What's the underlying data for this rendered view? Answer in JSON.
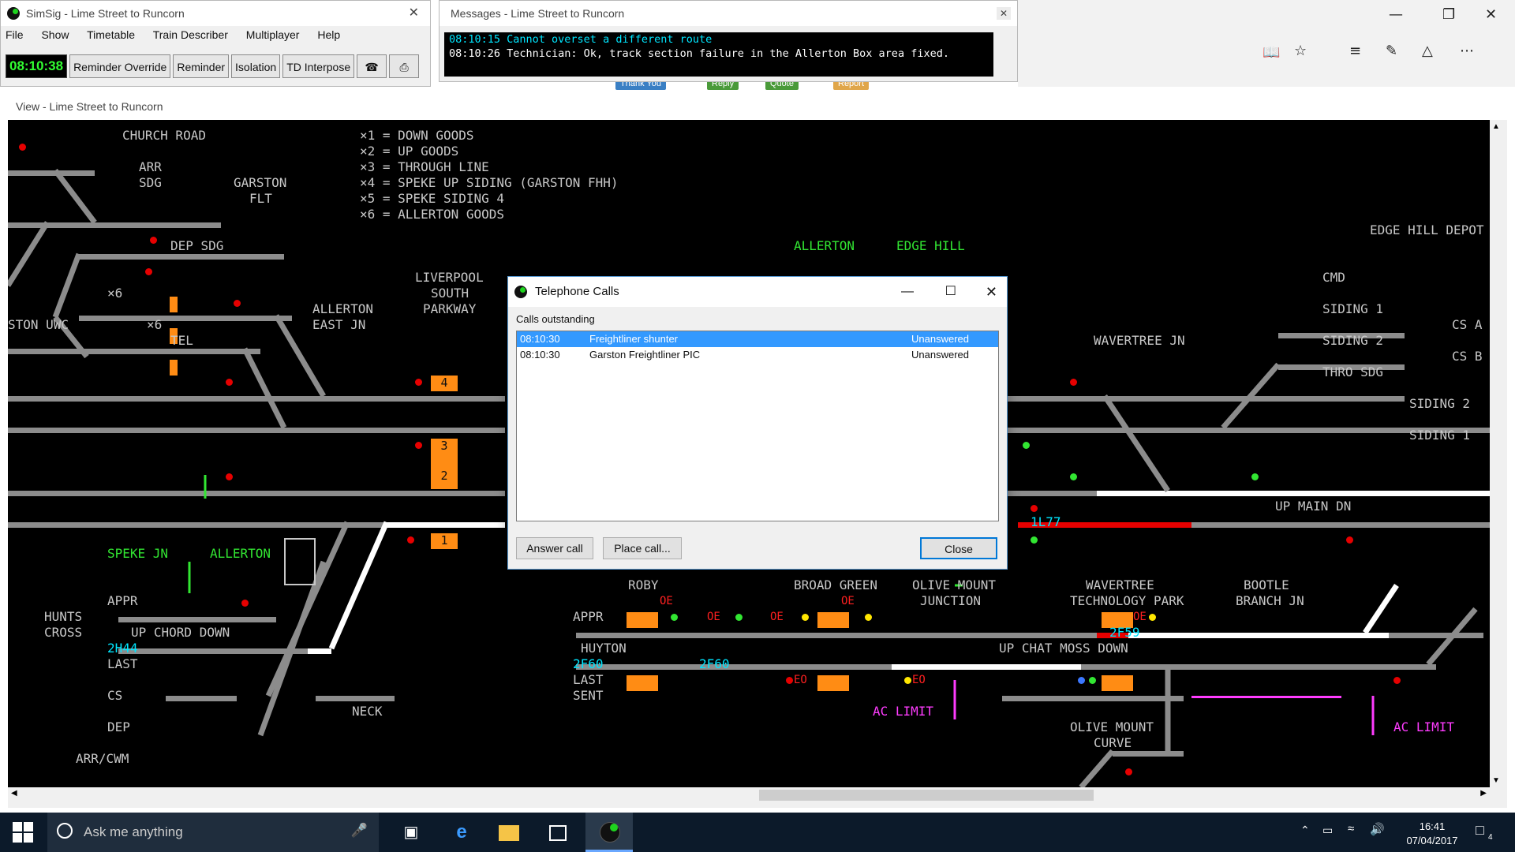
{
  "simsig": {
    "title": "SimSig - Lime Street to Runcorn",
    "menu": [
      "File",
      "Show",
      "Timetable",
      "Train Describer",
      "Multiplayer",
      "Help"
    ],
    "clock": "08:10:38",
    "toolbar": [
      "Reminder Override",
      "Reminder",
      "Isolation",
      "TD Interpose"
    ]
  },
  "messages": {
    "title": "Messages - Lime Street to Runcorn",
    "lines": [
      {
        "text": "08:10:15 Cannot overset a different route",
        "color": "#00e6ff"
      },
      {
        "text": "08:10:26 Technician: Ok, track section failure in the Allerton Box area fixed.",
        "color": "#ffffff"
      }
    ]
  },
  "forum_buttons": [
    "Thank You",
    "Reply",
    "Quote",
    "Report"
  ],
  "view": {
    "title": "View - Lime Street to Runcorn",
    "legend": [
      "×1 = DOWN GOODS",
      "×2 = UP GOODS",
      "×3 = THROUGH LINE",
      "×4 = SPEKE UP SIDING (GARSTON FHH)",
      "×5 = SPEKE SIDING 4",
      "×6 = ALLERTON GOODS"
    ],
    "labels": {
      "church_road": "CHURCH ROAD",
      "arr": "ARR",
      "sdg": "SDG",
      "garston": "GARSTON",
      "flt": "FLT",
      "dep_sdg": "DEP SDG",
      "x6a": "×6",
      "x6b": "×6",
      "ton_uwc": "STON UWC",
      "tel": "TEL",
      "liverpool": "LIVERPOOL",
      "south": "SOUTH",
      "parkway": "PARKWAY",
      "allerton_east": "ALLERTON",
      "east_jn": "EAST JN",
      "allerton_top": "ALLERTON",
      "edge_hill": "EDGE HILL",
      "edge_hill_depot": "EDGE HILL DEPOT",
      "cmd": "CMD",
      "siding1": "SIDING 1",
      "siding2": "SIDING 2",
      "thro_sdg": "THRO SDG",
      "cs_a": "CS A",
      "cs_b": "CS B",
      "siding2r": "SIDING 2",
      "siding1r": "SIDING 1",
      "wavertree_jn": "WAVERTREE JN",
      "up_main_dn": "UP MAIN DN",
      "td_1l77": "1L77",
      "speke_jn": "SPEKE JN",
      "allerton_g": "ALLERTON",
      "hunts": "HUNTS",
      "cross": "CROSS",
      "appr": "APPR",
      "up_chord_down": "UP CHORD DOWN",
      "td_2h44": "2H44",
      "last": "LAST",
      "cs": "CS",
      "dep": "DEP",
      "arr_cwm": "ARR/CWM",
      "neck": "NECK",
      "roby": "ROBY",
      "broad_green": "BROAD GREEN",
      "olive_mount": "OLIVE MOUNT",
      "junction": "JUNCTION",
      "wavertree": "WAVERTREE",
      "tech_park": "TECHNOLOGY PARK",
      "bootle": "BOOTLE",
      "branch_jn": "BRANCH JN",
      "appr2": "APPR",
      "huyton": "HUYTON",
      "td_2f60a": "2F60",
      "td_2f60b": "2F60",
      "last2": "LAST",
      "sent": "SENT",
      "td_2f59": "2F59",
      "up_chat_moss": "UP CHAT MOSS DOWN",
      "ac_limit1": "AC LIMIT",
      "ac_limit2": "AC LIMIT",
      "olive_mount_curve": "OLIVE MOUNT",
      "curve": "CURVE",
      "oe1": "OE",
      "oe2": "OE",
      "oe3": "OE",
      "oe4": "OE",
      "oe5": "OE",
      "eo1": "EO",
      "eo2": "EO",
      "plat4": "4",
      "plat3": "3",
      "plat2": "2",
      "plat1": "1"
    }
  },
  "phone": {
    "title": "Telephone Calls",
    "list_label": "Calls outstanding",
    "calls": [
      {
        "time": "08:10:30",
        "caller": "Freightliner shunter",
        "status": "Unanswered"
      },
      {
        "time": "08:10:30",
        "caller": "Garston Freightliner PIC",
        "status": "Unanswered"
      }
    ],
    "answer": "Answer call",
    "place": "Place call...",
    "close": "Close"
  },
  "taskbar": {
    "search_placeholder": "Ask me anything",
    "time": "16:41",
    "date": "07/04/2017",
    "notif_count": "4"
  }
}
